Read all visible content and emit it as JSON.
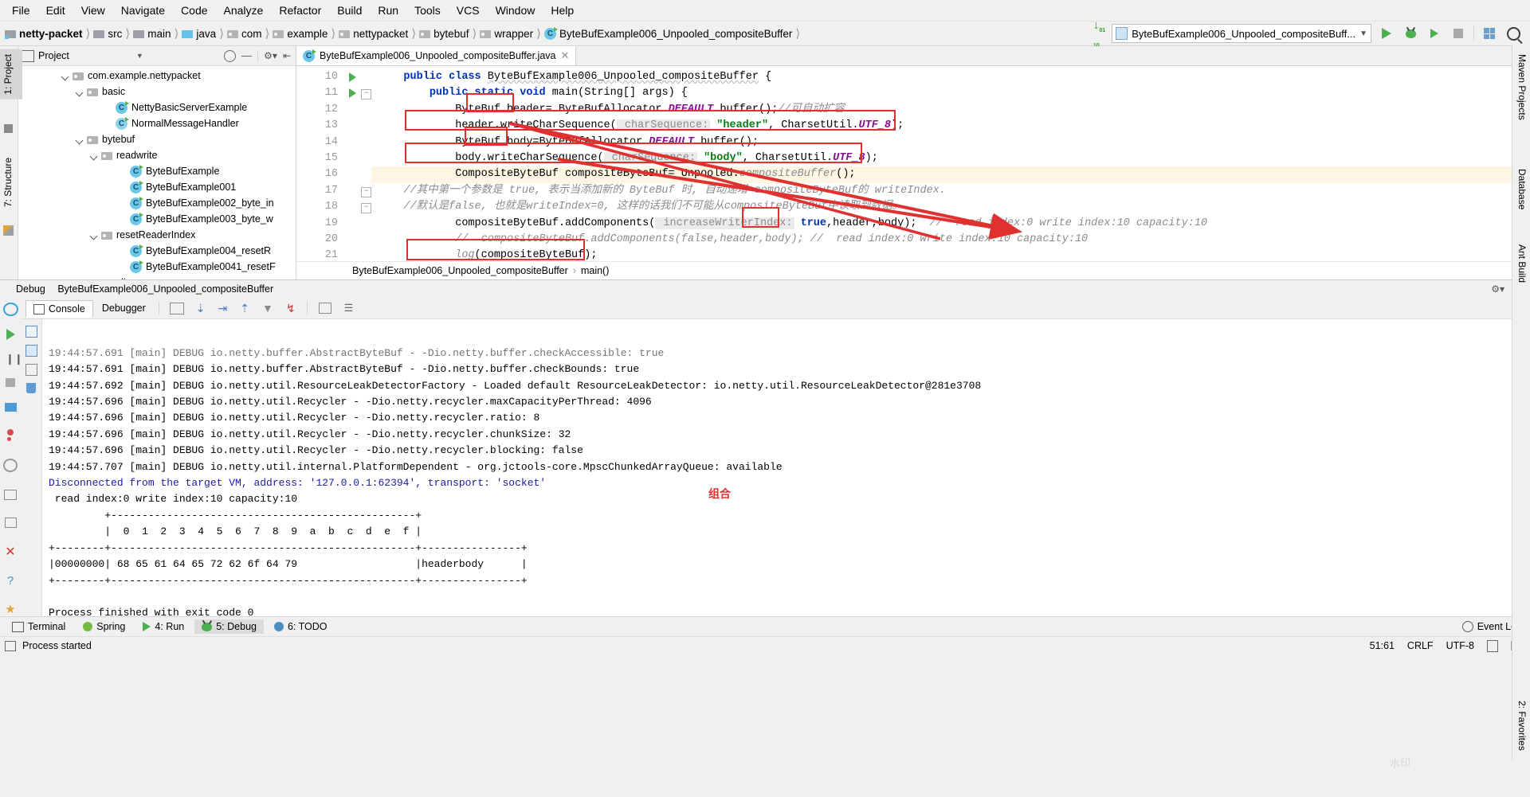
{
  "menu": {
    "items": [
      "File",
      "Edit",
      "View",
      "Navigate",
      "Code",
      "Analyze",
      "Refactor",
      "Build",
      "Run",
      "Tools",
      "VCS",
      "Window",
      "Help"
    ]
  },
  "breadcrumb": {
    "items": [
      {
        "label": "netty-packet",
        "icon": "module-folder-icon",
        "bold": true
      },
      {
        "label": "src",
        "icon": "folder-icon",
        "bold": false
      },
      {
        "label": "main",
        "icon": "folder-icon",
        "bold": false
      },
      {
        "label": "java",
        "icon": "source-folder-icon",
        "bold": false
      },
      {
        "label": "com",
        "icon": "package-icon",
        "bold": false
      },
      {
        "label": "example",
        "icon": "package-icon",
        "bold": false
      },
      {
        "label": "nettypacket",
        "icon": "package-icon",
        "bold": false
      },
      {
        "label": "bytebuf",
        "icon": "package-icon",
        "bold": false
      },
      {
        "label": "wrapper",
        "icon": "package-icon",
        "bold": false
      },
      {
        "label": "ByteBufExample006_Unpooled_compositeBuffer",
        "icon": "java-class-icon",
        "bold": false
      }
    ]
  },
  "toolbar": {
    "run_configuration": "ByteBufExample006_Unpooled_compositeBuff...",
    "run_button": "run-button",
    "debug_button": "debug-button",
    "run_coverage_button": "run-with-coverage-button",
    "stop_button": "stop-button",
    "update_button": "update-running-application-button",
    "search_button": "search-everywhere-button",
    "download_button": "download-updates-button"
  },
  "left_stripes": [
    {
      "label": "1: Project",
      "selected": true
    },
    {
      "label": "7: Structure",
      "selected": false
    }
  ],
  "right_stripes": [
    "Maven Projects",
    "Database",
    "Ant Build",
    "2: Favorites"
  ],
  "project_panel": {
    "title": "Project",
    "tree": [
      {
        "indent": 3,
        "type": "package",
        "label": "com.example.nettypacket",
        "expanded": true
      },
      {
        "indent": 4,
        "type": "package",
        "label": "basic",
        "expanded": true
      },
      {
        "indent": 6,
        "type": "class",
        "label": "NettyBasicServerExample",
        "runnable": true
      },
      {
        "indent": 6,
        "type": "class",
        "label": "NormalMessageHandler",
        "runnable": false
      },
      {
        "indent": 4,
        "type": "package",
        "label": "bytebuf",
        "expanded": true
      },
      {
        "indent": 5,
        "type": "package",
        "label": "readwrite",
        "expanded": true
      },
      {
        "indent": 7,
        "type": "class",
        "label": "ByteBufExample",
        "runnable": true
      },
      {
        "indent": 7,
        "type": "class",
        "label": "ByteBufExample001",
        "runnable": true
      },
      {
        "indent": 7,
        "type": "class",
        "label": "ByteBufExample002_byte_in",
        "runnable": true
      },
      {
        "indent": 7,
        "type": "class",
        "label": "ByteBufExample003_byte_w",
        "runnable": true
      },
      {
        "indent": 5,
        "type": "package",
        "label": "resetReaderIndex",
        "expanded": true
      },
      {
        "indent": 7,
        "type": "class",
        "label": "ByteBufExample004_resetR",
        "runnable": true
      },
      {
        "indent": 7,
        "type": "class",
        "label": "ByteBufExample0041_resetF",
        "runnable": true
      },
      {
        "indent": 5,
        "type": "package",
        "label": "slice",
        "expanded": true
      }
    ]
  },
  "editor": {
    "tab": "ByteBufExample006_Unpooled_compositeBuffer.java",
    "breadcrumb_class": "ByteBufExample006_Unpooled_compositeBuffer",
    "breadcrumb_method": "main()",
    "lines": [
      {
        "n": "10",
        "run": true,
        "fold": false,
        "hl": false,
        "html": "    <span class=\"kw\">public class</span> <span class=\"wavy\">ByteBufExample006_Unpooled_compositeBuffer</span> {"
      },
      {
        "n": "11",
        "run": true,
        "fold": true,
        "hl": false,
        "html": "        <span class=\"kw\">public static void</span> main(String[] args) {"
      },
      {
        "n": "12",
        "run": false,
        "fold": false,
        "hl": false,
        "html": "            ByteBuf header= ByteBufAllocator.<span class=\"sf\">DEFAULT</span>.buffer();<span class=\"cmt\">//可自动扩容</span>"
      },
      {
        "n": "13",
        "run": false,
        "fold": false,
        "hl": false,
        "html": "            header.writeCharSequence(<span class=\"hint\"> charSequence:</span> <span class=\"str\">\"header\"</span>, CharsetUtil.<span class=\"sf\">UTF_8</span>);"
      },
      {
        "n": "14",
        "run": false,
        "fold": false,
        "hl": false,
        "html": "            ByteBuf body=ByteBufAllocator.<span class=\"sf\">DEFAULT</span>.buffer();"
      },
      {
        "n": "15",
        "run": false,
        "fold": false,
        "hl": false,
        "html": "            body.writeCharSequence(<span class=\"hint\"> charSequence:</span> <span class=\"str\">\"body\"</span>, CharsetUtil.<span class=\"sf\">UTF_8</span>);"
      },
      {
        "n": "16",
        "run": false,
        "fold": false,
        "hl": true,
        "html": "            CompositeByteBuf compositeByteBuf= Unpooled.<span class=\"cmt\">compositeBuffer</span>();"
      },
      {
        "n": "17",
        "run": false,
        "fold": true,
        "hl": false,
        "html": "<span class=\"cmt\">    //其中第一个参数是 true, 表示当添加新的 ByteBuf 时, 自动递增 compositeByteBuf的 writeIndex.</span>"
      },
      {
        "n": "18",
        "run": false,
        "fold": true,
        "hl": false,
        "html": "<span class=\"cmt\">    //默认是false, 也就是writeIndex=0, 这样的话我们不可能从compositeByteBuf中读取到数据。</span>"
      },
      {
        "n": "19",
        "run": false,
        "fold": false,
        "hl": false,
        "html": "            compositeByteBuf.addComponents(<span class=\"hint\"> increaseWriterIndex:</span> <span class=\"kw\">true</span>,header,body);  <span class=\"cmt\">//  read index:0 write index:10 capacity:10</span>"
      },
      {
        "n": "20",
        "run": false,
        "fold": false,
        "hl": false,
        "html": "            <span class=\"cmt\">//  compositeByteBuf.addComponents(false,header,body); //  read index:0 write index:10 capacity:10</span>"
      },
      {
        "n": "21",
        "run": false,
        "fold": false,
        "hl": false,
        "html": "            <span class=\"cmt\">log</span>(compositeByteBuf);"
      }
    ]
  },
  "debug": {
    "title": "Debug",
    "session": "ByteBufExample006_Unpooled_compositeBuffer",
    "tabs": [
      {
        "label": "Console",
        "selected": true,
        "icon": "console-icon"
      },
      {
        "label": "Debugger",
        "selected": false,
        "icon": "debugger-icon"
      }
    ],
    "console_lines": [
      {
        "text": "19:44:57.691 [main] DEBUG io.netty.buffer.AbstractByteBuf - -Dio.netty.buffer.checkAccessible: true",
        "color": "black",
        "partial": true
      },
      {
        "text": "19:44:57.691 [main] DEBUG io.netty.buffer.AbstractByteBuf - -Dio.netty.buffer.checkBounds: true",
        "color": "black"
      },
      {
        "text": "19:44:57.692 [main] DEBUG io.netty.util.ResourceLeakDetectorFactory - Loaded default ResourceLeakDetector: io.netty.util.ResourceLeakDetector@281e3708",
        "color": "black"
      },
      {
        "text": "19:44:57.696 [main] DEBUG io.netty.util.Recycler - -Dio.netty.recycler.maxCapacityPerThread: 4096",
        "color": "black"
      },
      {
        "text": "19:44:57.696 [main] DEBUG io.netty.util.Recycler - -Dio.netty.recycler.ratio: 8",
        "color": "black"
      },
      {
        "text": "19:44:57.696 [main] DEBUG io.netty.util.Recycler - -Dio.netty.recycler.chunkSize: 32",
        "color": "black"
      },
      {
        "text": "19:44:57.696 [main] DEBUG io.netty.util.Recycler - -Dio.netty.recycler.blocking: false",
        "color": "black"
      },
      {
        "text": "19:44:57.707 [main] DEBUG io.netty.util.internal.PlatformDependent - org.jctools-core.MpscChunkedArrayQueue: available",
        "color": "black"
      },
      {
        "text": "Disconnected from the target VM, address: '127.0.0.1:62394', transport: 'socket'",
        "color": "blue"
      },
      {
        "text": " read index:0 write index:10 capacity:10",
        "color": "black"
      },
      {
        "text": "         +-------------------------------------------------+",
        "color": "black"
      },
      {
        "text": "         |  0  1  2  3  4  5  6  7  8  9  a  b  c  d  e  f |",
        "color": "black"
      },
      {
        "text": "+--------+-------------------------------------------------+----------------+",
        "color": "black"
      },
      {
        "text": "|00000000| 68 65 61 64 65 72 62 6f 64 79                   |headerbody      |",
        "color": "black"
      },
      {
        "text": "+--------+-------------------------------------------------+----------------+",
        "color": "black"
      },
      {
        "text": "",
        "color": "black"
      },
      {
        "text": "Process finished with exit code 0",
        "color": "black"
      }
    ]
  },
  "annotations": {
    "label_zuhe": "组合"
  },
  "bottom_bar": {
    "items": [
      {
        "label": "Terminal",
        "icon": "terminal-icon",
        "selected": false
      },
      {
        "label": "Spring",
        "icon": "spring-icon",
        "selected": false
      },
      {
        "label": "4: Run",
        "icon": "run-icon",
        "selected": false
      },
      {
        "label": "5: Debug",
        "icon": "debug-icon",
        "selected": true
      },
      {
        "label": "6: TODO",
        "icon": "todo-icon",
        "selected": false
      }
    ],
    "event_log": "Event Log"
  },
  "status_bar": {
    "message": "Process started",
    "caret": "51:61",
    "line_sep": "CRLF",
    "encoding": "UTF-8"
  }
}
